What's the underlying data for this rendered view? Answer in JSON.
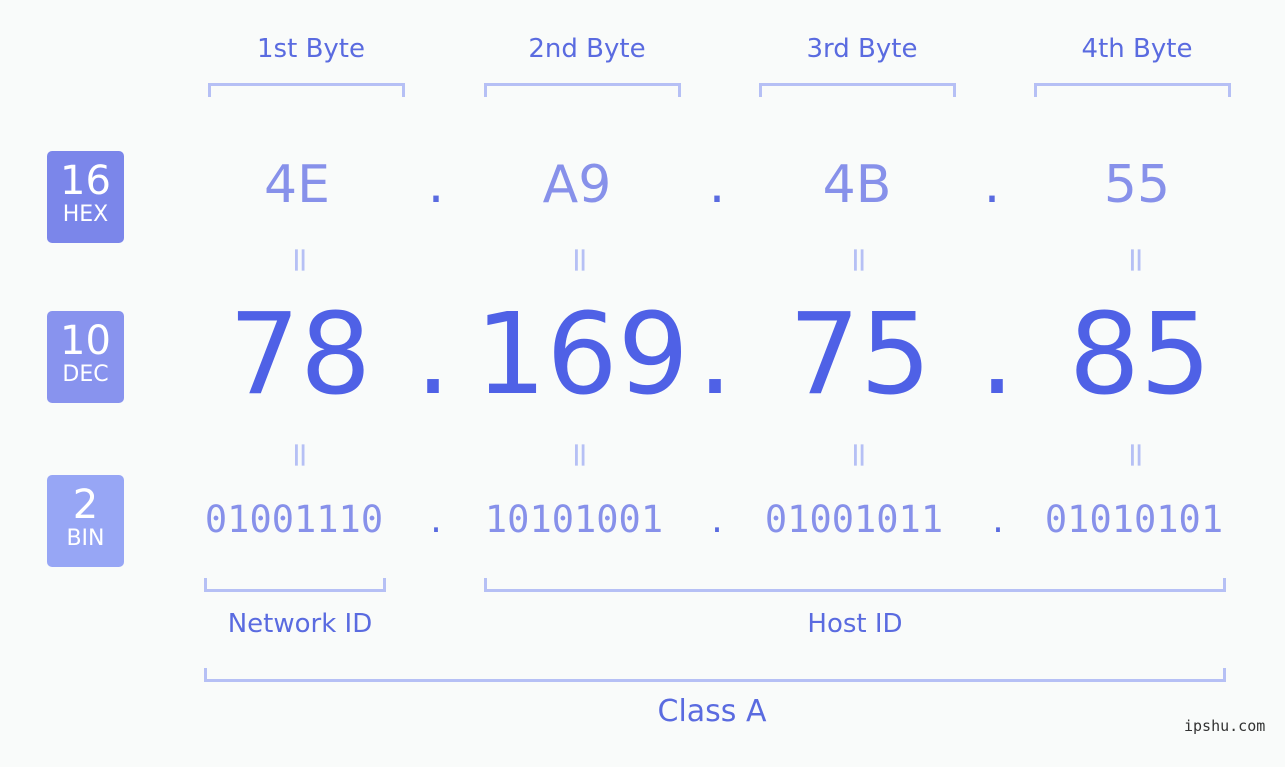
{
  "byte_headers": [
    "1st Byte",
    "2nd Byte",
    "3rd Byte",
    "4th Byte"
  ],
  "badges": {
    "hex": {
      "num": "16",
      "label": "HEX",
      "color": "#7b86ea"
    },
    "dec": {
      "num": "10",
      "label": "DEC",
      "color": "#8893ee"
    },
    "bin": {
      "num": "2",
      "label": "BIN",
      "color": "#97a6f5"
    }
  },
  "separator": ".",
  "equals": "=",
  "hex": [
    "4E",
    "A9",
    "4B",
    "55"
  ],
  "dec": [
    "78",
    "169",
    "75",
    "85"
  ],
  "bin": [
    "01001110",
    "10101001",
    "01001011",
    "01010101"
  ],
  "network_label": "Network ID",
  "host_label": "Host ID",
  "class_label": "Class A",
  "watermark": "ipshu.com",
  "colors": {
    "background": "#f9fbfa",
    "primary": "#4f61e6",
    "light": "#8791ea",
    "bracket": "#b6c0f5"
  }
}
